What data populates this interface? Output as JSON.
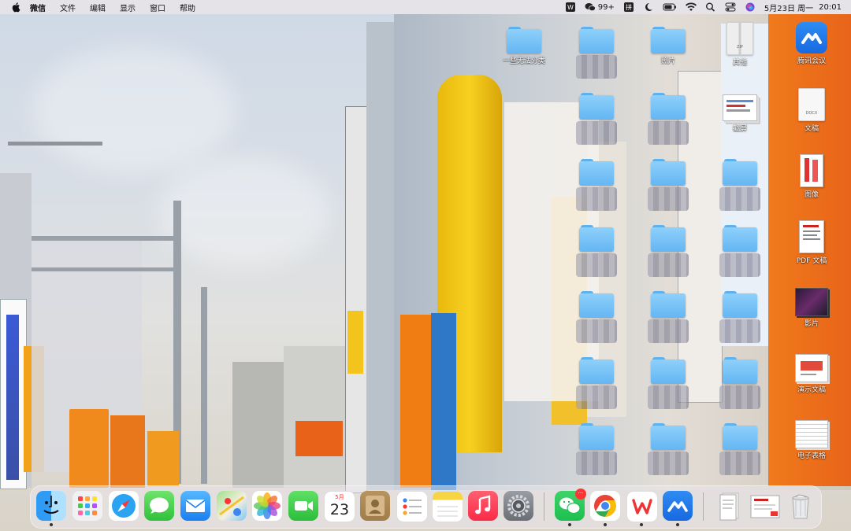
{
  "menubar": {
    "apple": "apple-logo",
    "items": [
      "微信",
      "文件",
      "编辑",
      "显示",
      "窗口",
      "帮助"
    ],
    "right": {
      "badge_count": "99+",
      "date": "5月23日 周一",
      "time": "20:01"
    }
  },
  "desktop": {
    "labeled_icons": [
      {
        "label": "一些无法分类",
        "type": "folder"
      },
      {
        "label": "照片",
        "type": "folder"
      },
      {
        "label": "其他",
        "type": "zip",
        "ext": "ZIP"
      },
      {
        "label": "腾讯会议",
        "type": "app"
      },
      {
        "label": "截屏",
        "type": "screenshot"
      },
      {
        "label": "文稿",
        "type": "doc",
        "ext": "DOCX"
      },
      {
        "label": "图像",
        "type": "image"
      },
      {
        "label": "PDF 文稿",
        "type": "pdf"
      },
      {
        "label": "影片",
        "type": "movie"
      },
      {
        "label": "演示文稿",
        "type": "presentation"
      },
      {
        "label": "电子表格",
        "type": "spreadsheet"
      }
    ]
  },
  "dock": {
    "calendar_month": "5月",
    "calendar_day": "23",
    "wechat_badge": "···",
    "apps": [
      "Finder",
      "Launchpad",
      "Safari",
      "信息",
      "邮件",
      "地图",
      "照片",
      "FaceTime",
      "日历",
      "通讯录",
      "提醒事项",
      "备忘录",
      "音乐",
      "系统偏好设置",
      "微信",
      "Chrome",
      "WPS Office",
      "腾讯会议",
      "文稿",
      "PDF",
      "废纸篓"
    ]
  }
}
